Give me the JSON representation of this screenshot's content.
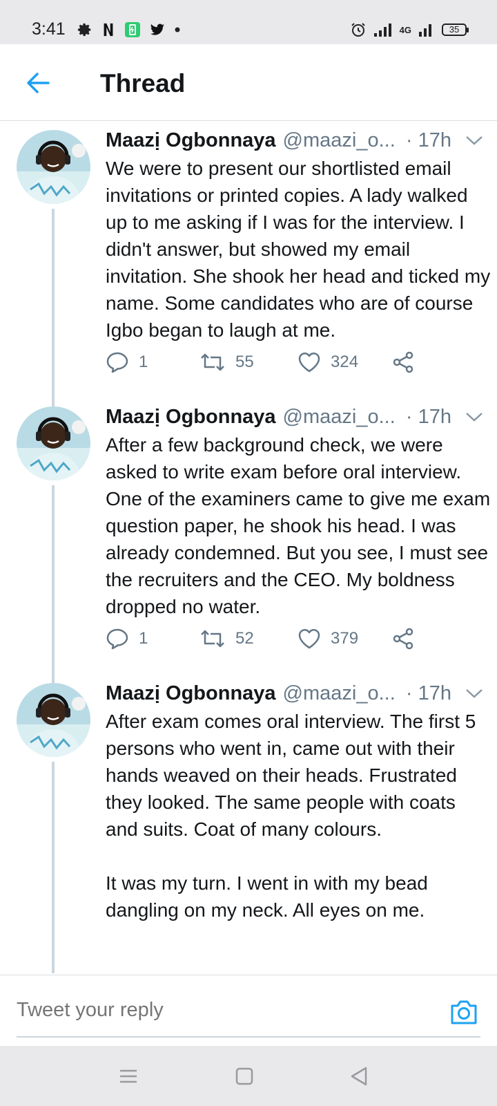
{
  "status_bar": {
    "time": "3:41",
    "left_icons": [
      "gear-icon",
      "netflix-icon",
      "battery-saver-icon",
      "twitter-icon",
      "dot-icon"
    ],
    "right_icons": [
      "alarm-icon",
      "signal-icon",
      "4g-signal-icon",
      "battery-icon"
    ],
    "network": "4G",
    "battery": "35"
  },
  "header": {
    "back_icon": "arrow-left-icon",
    "title": "Thread"
  },
  "tweets": [
    {
      "name": "Maazị Ogbonnaya",
      "handle": "@maazi_o...",
      "time": "· 17h",
      "body": "We were to present our shortlisted email invitations or printed copies. A lady walked up to me asking if I was for the interview. I didn't answer, but showed my email invitation. She shook her head and ticked my name. Some candidates who are of course Igbo began to laugh at me.",
      "replies": "1",
      "retweets": "55",
      "likes": "324"
    },
    {
      "name": "Maazị Ogbonnaya",
      "handle": "@maazi_o...",
      "time": "· 17h",
      "body": "After a few background check, we were asked to write exam before oral interview. One of the examiners came to give me exam question paper, he shook his head. I was already condemned. But you see, I must see the recruiters and the CEO. My boldness dropped no water.",
      "replies": "1",
      "retweets": "52",
      "likes": "379"
    },
    {
      "name": "Maazị Ogbonnaya",
      "handle": "@maazi_o...",
      "time": "· 17h",
      "body": "After exam comes oral interview. The first 5 persons who went in, came out with their hands weaved on their heads. Frustrated they looked. The same people with coats and suits. Coat of many colours.\n\nIt was my turn. I went in with my bead dangling on my neck. All eyes on me."
    }
  ],
  "reply_bar": {
    "placeholder": "Tweet your reply",
    "camera_icon": "camera-icon"
  },
  "nav_bar": {
    "icons": [
      "menu-icon",
      "home-square-icon",
      "back-triangle-icon"
    ]
  },
  "colors": {
    "accent": "#1da1f2",
    "text": "#14171a",
    "secondary_text": "#657786",
    "thread_line": "#ccd6dd",
    "system_bar": "#e9e9ec"
  }
}
